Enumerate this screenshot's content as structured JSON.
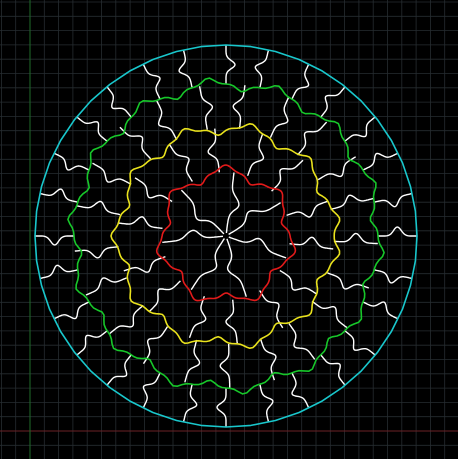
{
  "canvas": {
    "background": "#000000",
    "grid_color": "#262c30",
    "axis_x_color": "#6b2226",
    "axis_y_color": "#1f6b2a"
  },
  "puzzle": {
    "shape": "circular jigsaw",
    "rings": [
      {
        "name": "outer-boundary",
        "color": "#19c7cc",
        "kind": "smooth circle"
      },
      {
        "name": "ring-3",
        "color": "#17c72a",
        "kind": "tabbed ring"
      },
      {
        "name": "ring-2",
        "color": "#e9e21d",
        "kind": "tabbed ring"
      },
      {
        "name": "ring-1",
        "color": "#e21a1a",
        "kind": "tabbed ring"
      }
    ],
    "cut_color": "#ffffff",
    "piece_counts_by_band": {
      "center": 7,
      "band-2": 14,
      "band-3": 21,
      "band-4": 28
    }
  }
}
